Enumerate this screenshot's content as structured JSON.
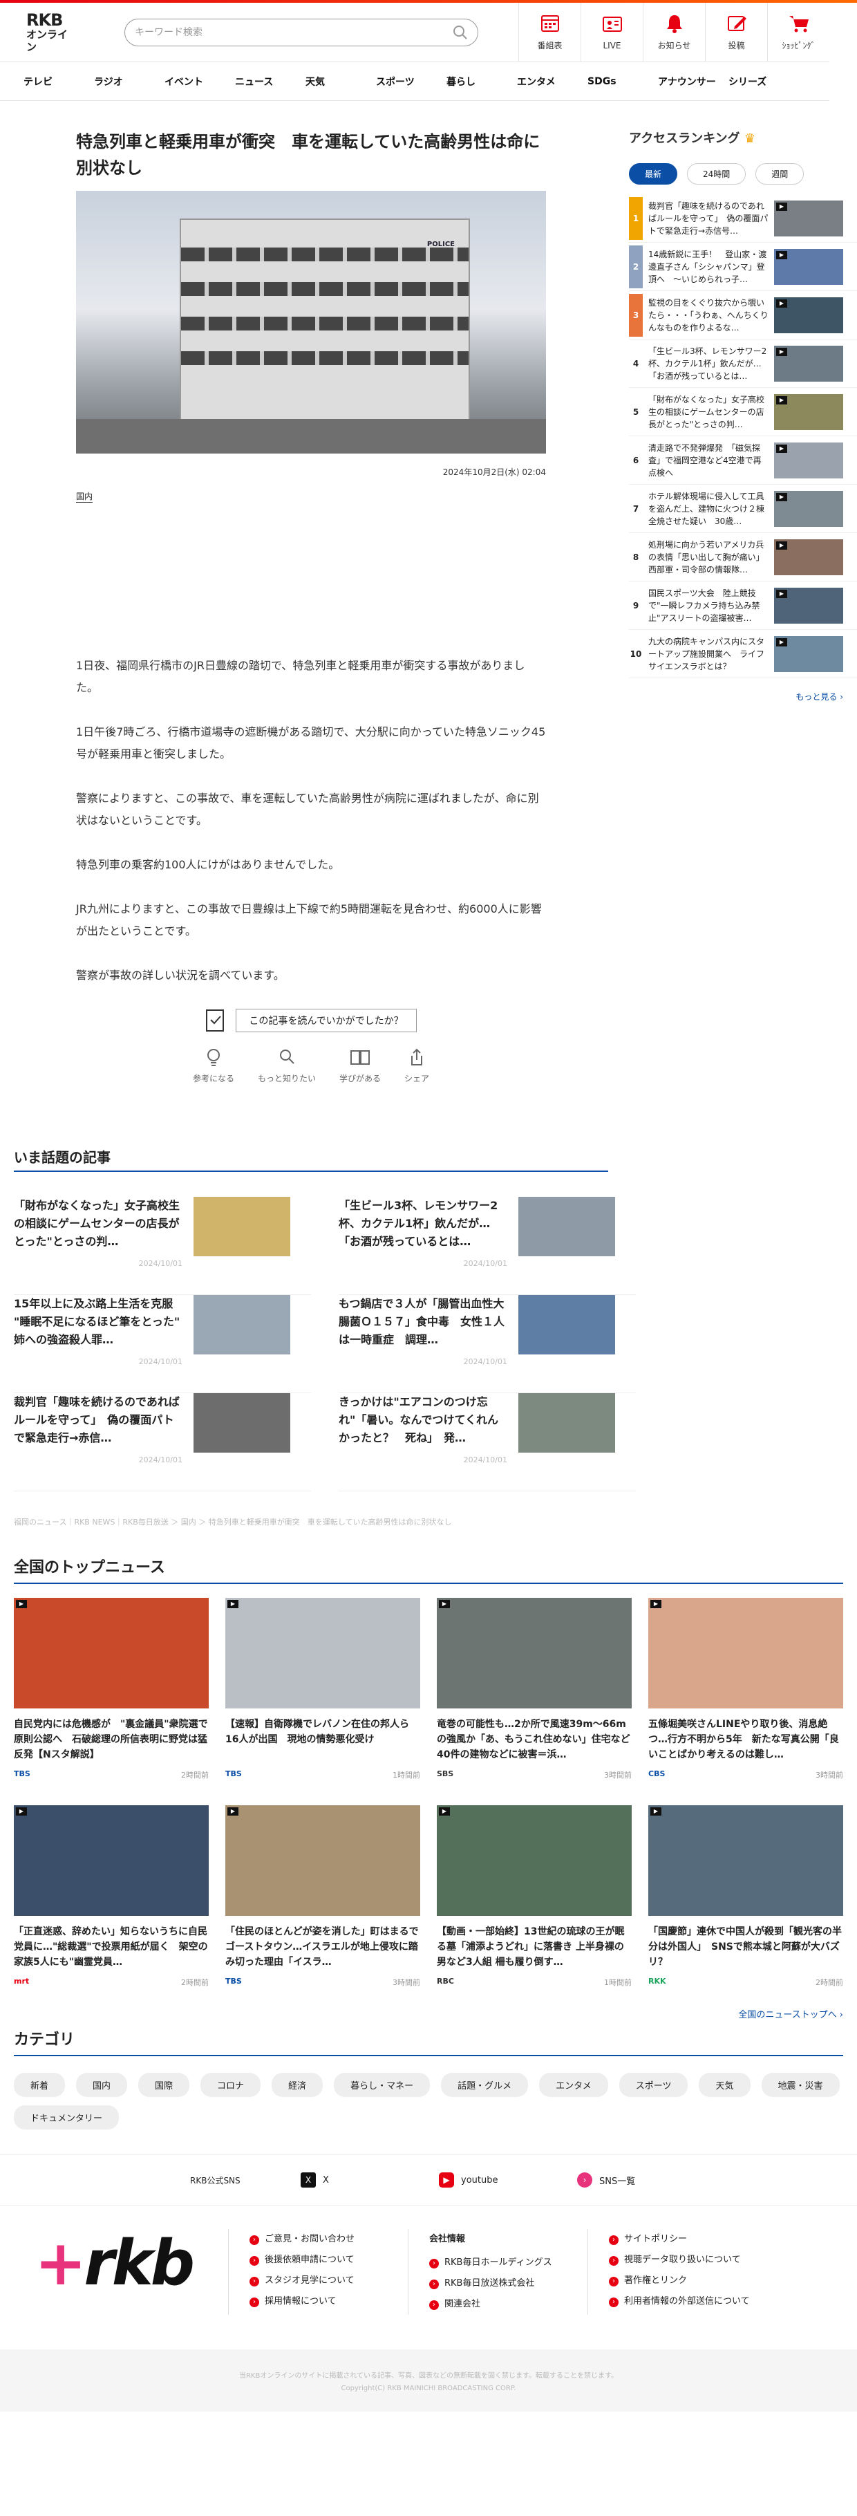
{
  "header": {
    "logo_l1": "RKB",
    "logo_l2": "オンライン",
    "search_placeholder": "キーワード検索",
    "icons": [
      {
        "label": "番組表",
        "icon": "calendar-icon",
        "color": "#e60012"
      },
      {
        "label": "LIVE",
        "icon": "live-icon",
        "color": "#e60012"
      },
      {
        "label": "お知らせ",
        "icon": "bell-icon",
        "color": "#e60012"
      },
      {
        "label": "投稿",
        "icon": "post-icon",
        "color": "#e60012"
      },
      {
        "label": "ｼｮｯﾋﾟﾝｸﾞ",
        "icon": "cart-icon",
        "color": "#e60012"
      }
    ]
  },
  "nav": [
    "テレビ",
    "ラジオ",
    "イベント",
    "ニュース",
    "天気",
    "スポーツ",
    "暮らし",
    "エンタメ",
    "SDGs",
    "アナウンサー",
    "シリーズ"
  ],
  "article": {
    "title": "特急列車と軽乗用車が衝突　車を運転していた高齢男性は命に別状なし",
    "police_sign": "POLICE",
    "date": "2024年10月2日(水) 02:04",
    "tag": "国内",
    "paragraphs": [
      "1日夜、福岡県行橋市のJR日豊線の踏切で、特急列車と軽乗用車が衝突する事故がありました。",
      "1日午後7時ごろ、行橋市道場寺の遮断機がある踏切で、大分駅に向かっていた特急ソニック45号が軽乗用車と衝突しました。",
      "警察によりますと、この事故で、車を運転していた高齢男性が病院に運ばれましたが、命に別状はないということです。",
      "特急列車の乗客約100人にけがはありませんでした。",
      "JR九州によりますと、この事故で日豊線は上下線で約5時間運転を見合わせ、約6000人に影響が出たということです。",
      "警察が事故の詳しい状況を調べています。"
    ],
    "feedback_q": "この記事を読んでいかがでしたか？",
    "reactions": [
      {
        "label": "参考になる",
        "icon": "bulb-icon"
      },
      {
        "label": "もっと知りたい",
        "icon": "magnifier-icon"
      },
      {
        "label": "学びがある",
        "icon": "book-icon"
      },
      {
        "label": "シェア",
        "icon": "share-icon"
      }
    ]
  },
  "ranking": {
    "title": "アクセスランキング",
    "tabs": [
      "最新",
      "24時間",
      "週間"
    ],
    "more": "もっと見る ›",
    "items": [
      {
        "no": "1",
        "text": "裁判官「趣味を続けるのであればルールを守って」　偽の覆面パトで緊急走行→赤信号…"
      },
      {
        "no": "2",
        "text": "14歳新鋭に王手！　登山家・渡邊直子さん「シシャパンマ」登頂へ　〜いじめられっ子…"
      },
      {
        "no": "3",
        "text": "監視の目をくぐり抜穴から覗いたら・・・「うわぁ、へんちくりんなものを作りよるな…"
      },
      {
        "no": "4",
        "text": "「生ビール3杯、レモンサワー2杯、カクテル1杯」飲んだが…「お酒が残っているとは…"
      },
      {
        "no": "5",
        "text": "「財布がなくなった」女子高校生の相談にゲームセンターの店長がとった\"とっさの判…"
      },
      {
        "no": "6",
        "text": "清走路で不発弾爆発　「磁気探査」で福岡空港など4空港で再点検へ"
      },
      {
        "no": "7",
        "text": "ホテル解体現場に侵入して工具を盗んだ上、建物に火つけ２棟全焼させた疑い　30歳…"
      },
      {
        "no": "8",
        "text": "処刑場に向かう若いアメリカ兵の表情「思い出して胸が痛い」西部軍・司令部の情報隊…"
      },
      {
        "no": "9",
        "text": "国民スポーツ大会　陸上競技で\"一瞬レフカメラ持ち込み禁止\"アスリートの盗撮被害…"
      },
      {
        "no": "10",
        "text": "九大の病院キャンパス内にスタートアップ施設開業へ　ライフサイエンスラボとは？"
      }
    ]
  },
  "hot": {
    "title": "いま話題の記事",
    "items": [
      {
        "text": "「財布がなくなった」女子高校生の相談にゲームセンターの店長がとった\"とっさの判…",
        "date": "2024/10/01"
      },
      {
        "text": "「生ビール3杯、レモンサワー2杯、カクテル1杯」飲んだが…「お酒が残っているとは…",
        "date": "2024/10/01"
      },
      {
        "text": "15年以上に及ぶ路上生活を克服 \"睡眠不足になるほど筆をとった\"　姉への強盗殺人罪…",
        "date": "2024/10/01"
      },
      {
        "text": "もつ鍋店で３人が「腸管出血性大腸菌Ｏ１５７」食中毒　女性１人は一時重症　調理…",
        "date": "2024/10/01"
      },
      {
        "text": "裁判官「趣味を続けるのであればルールを守って」　偽の覆面パトで緊急走行→赤信…",
        "date": "2024/10/01"
      },
      {
        "text": "きっかけは\"エアコンのつけ忘れ\"「暑い。なんでつけてくれんかったと？　死ね」　発…",
        "date": "2024/10/01"
      }
    ],
    "breadcrumb": "福岡のニュース｜RKB NEWS｜RKB毎日放送 ＞ 国内 ＞ 特急列車と軽乗用車が衝突　車を運転していた高齢男性は命に別状なし"
  },
  "topnews": {
    "title": "全国のトップニュース",
    "more": "全国のニューストップへ ›",
    "items": [
      {
        "text": "自民党内には危機感が　\"裏金議員\"衆院選で原則公認へ　石破総理の所信表明に野党は猛反発【Nスタ解説】",
        "src": "TBS",
        "time": "2時間前",
        "srccolor": "#0a4ea6",
        "img": "#c84a2b"
      },
      {
        "text": "【速報】自衛隊機でレバノン在住の邦人ら16人が出国　現地の情勢悪化受け",
        "src": "TBS",
        "time": "1時間前",
        "srccolor": "#0a4ea6",
        "img": "#b9bfc4"
      },
      {
        "text": "竜巻の可能性も…2か所で風速39m～66mの強風か「あ、もうこれ住めない」住宅など40件の建物などに被害＝浜…",
        "src": "SBS",
        "time": "3時間前",
        "srccolor": "#333",
        "img": "#6d7572"
      },
      {
        "text": "五條堀美咲さんLINEやり取り後、消息絶つ…行方不明から5年　新たな写真公開「良いことばかり考えるのは難し…",
        "src": "CBS",
        "time": "3時間前",
        "srccolor": "#0a4ea6",
        "img": "#d9a58b"
      },
      {
        "text": "「正直迷惑、辞めたい」知らないうちに自民党員に…\"総裁選\"で投票用紙が届く　架空の家族5人にも\"幽霊党員…",
        "src": "mrt",
        "time": "2時間前",
        "srccolor": "#e60012",
        "img": "#3b4f6a"
      },
      {
        "text": "「住民のほとんどが姿を消した」町はまるでゴーストタウン…イスラエルが地上侵攻に踏み切った理由「イスラ…",
        "src": "TBS",
        "time": "3時間前",
        "srccolor": "#0a4ea6",
        "img": "#a89272"
      },
      {
        "text": "【動画・一部始終】13世紀の琉球の王が眠る墓「浦添ようどれ」に落書き 上半身裸の男など3人組 柵も履り倒す…",
        "src": "RBC",
        "time": "1時間前",
        "srccolor": "#333",
        "img": "#55705a"
      },
      {
        "text": "「国慶節」連休で中国人が殺到「観光客の半分は外国人」　SNSで熊本城と阿蘇が大バズリ？",
        "src": "RKK",
        "time": "2時間前",
        "srccolor": "#1aa35a",
        "img": "#566b7c"
      }
    ]
  },
  "categories": {
    "title": "カテゴリ",
    "items": [
      "新着",
      "国内",
      "国際",
      "コロナ",
      "経済",
      "暮らし・マネー",
      "話題・グルメ",
      "エンタメ",
      "スポーツ",
      "天気",
      "地震・災害",
      "ドキュメンタリー"
    ]
  },
  "sns": {
    "label": "RKB公式SNS",
    "items": [
      {
        "name": "X",
        "color": "#111"
      },
      {
        "name": "youtube",
        "color": "#e60012"
      },
      {
        "name": "SNS一覧",
        "color": "#e8327c"
      }
    ]
  },
  "footer": {
    "logo": "rkb",
    "col1": [
      "ご意見・お問い合わせ",
      "後援依頼申請について",
      "スタジオ見学について",
      "採用情報について"
    ],
    "col2_title": "会社情報",
    "col2": [
      "RKB毎日ホールディングス",
      "RKB毎日放送株式会社",
      "関連会社"
    ],
    "col3": [
      "サイトポリシー",
      "視聴データ取り扱いについて",
      "著作権とリンク",
      "利用者情報の外部送信について"
    ],
    "copy1": "当RKBオンラインのサイトに掲載されている記事、写真、図表などの無断転載を固く禁じます。転載することを禁じます。",
    "copy2": "Copyright(C) RKB MAINICHI BROADCASTING CORP."
  }
}
